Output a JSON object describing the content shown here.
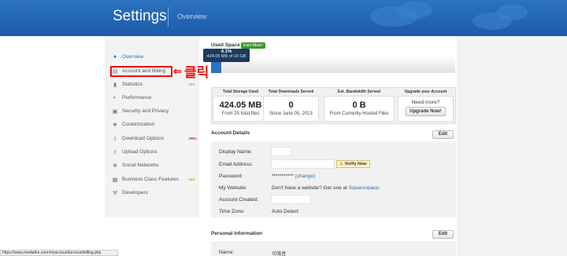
{
  "header": {
    "title": "Settings",
    "subtitle": "Overview"
  },
  "sidebar": {
    "items": [
      {
        "label": "Overview",
        "icon": "user-icon",
        "active": true,
        "tag": ""
      },
      {
        "label": "Account and Billing",
        "icon": "card-icon",
        "active": false,
        "tag": ""
      },
      {
        "label": "Statistics",
        "icon": "chart-icon",
        "active": false,
        "tag": "BIZ"
      },
      {
        "label": "Performance",
        "icon": "gauge-icon",
        "active": false,
        "tag": ""
      },
      {
        "label": "Security and Privacy",
        "icon": "lock-icon",
        "active": false,
        "tag": ""
      },
      {
        "label": "Customization",
        "icon": "palette-icon",
        "active": false,
        "tag": ""
      },
      {
        "label": "Download Options",
        "icon": "download-icon",
        "active": false,
        "tag": "PRO"
      },
      {
        "label": "Upload Options",
        "icon": "upload-icon",
        "active": false,
        "tag": ""
      },
      {
        "label": "Social Networks",
        "icon": "share-icon",
        "active": false,
        "tag": ""
      },
      {
        "label": "Business Class Features",
        "icon": "briefcase-icon",
        "active": false,
        "tag": "BIZ"
      },
      {
        "label": "Developers",
        "icon": "wrench-icon",
        "active": false,
        "tag": ""
      }
    ]
  },
  "annotation": {
    "korean_text": "클릭"
  },
  "used_space": {
    "label": "Used Space",
    "earn_more": "Earn More!",
    "percent": "4.1%",
    "detail": "424.05 MB of 10 GB",
    "fraction": 0.041
  },
  "stats": [
    {
      "heading": "Total Storage Used",
      "value": "424.05 MB",
      "sub": "From 25 total files"
    },
    {
      "heading": "Total Downloads Served",
      "value": "0",
      "sub": "Since June 05, 2013"
    },
    {
      "heading": "Est. Bandwidth Served",
      "value": "0 B",
      "sub": "From Currently Hosted Files"
    },
    {
      "heading": "Upgrade your Account",
      "need": "Need more?",
      "button": "Upgrade Now!"
    }
  ],
  "account": {
    "title": "Account Details",
    "edit": "Edit",
    "rows": [
      {
        "label": "Display Name:",
        "value": ""
      },
      {
        "label": "Email Address:",
        "value": ""
      },
      {
        "label": "Password:",
        "value": "***********",
        "link": "(change)"
      },
      {
        "label": "My Website:",
        "value": "Don't have a website? Get one at",
        "link": "Squarespace",
        "tail": "."
      },
      {
        "label": "Account Created:",
        "value": ""
      },
      {
        "label": "Time Zone:",
        "value": "Auto Detect"
      }
    ],
    "verify": "Verify Now"
  },
  "personal": {
    "title": "Personal Information",
    "edit": "Edit",
    "name_label": "Name:",
    "name_value": "이혜경"
  },
  "statusbar": {
    "url": "https://www.mediafire.com/myaccount/accountbilling.php"
  }
}
